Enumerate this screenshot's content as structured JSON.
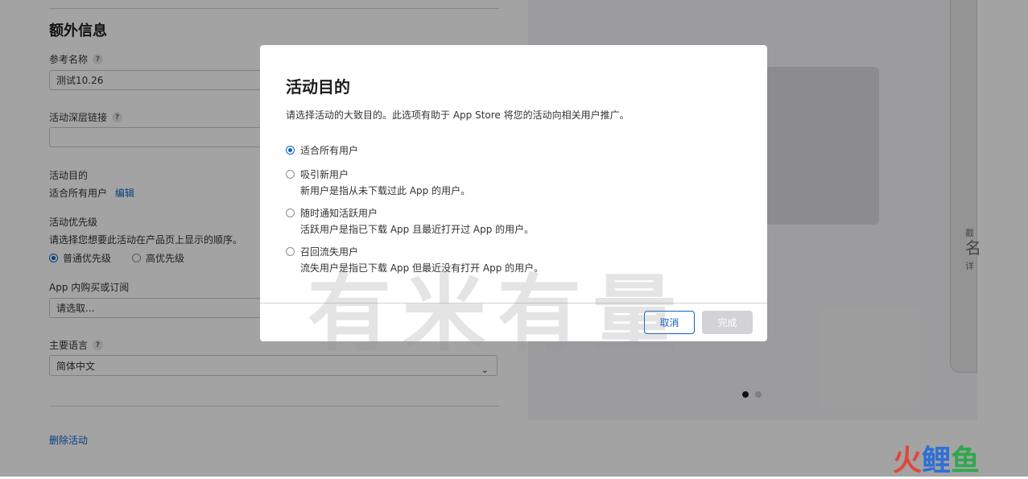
{
  "form": {
    "section_title": "额外信息",
    "ref_name": {
      "label": "参考名称",
      "help": "?",
      "value": "测试10.26"
    },
    "deep_link": {
      "label": "活动深层链接",
      "help": "?",
      "value": ""
    },
    "purpose": {
      "label": "活动目的",
      "value": "适合所有用户",
      "edit": "编辑"
    },
    "priority": {
      "label": "活动优先级",
      "desc": "请选择您想要此活动在产品页上显示的顺序。",
      "options": [
        {
          "label": "普通优先级",
          "selected": true
        },
        {
          "label": "高优先级",
          "selected": false
        }
      ]
    },
    "iap": {
      "label": "App 内购买或订阅",
      "placeholder": "请选取..."
    },
    "language": {
      "label": "主要语言",
      "help": "?",
      "value": "简体中文"
    },
    "delete_link": "删除活动"
  },
  "preview": {
    "device_text_top": "截",
    "device_text_big": "名",
    "device_text_bottom": "详",
    "page_dots": {
      "count": 2,
      "active": 1
    }
  },
  "modal": {
    "title": "活动目的",
    "description": "请选择活动的大致目的。此选项有助于 App Store 将您的活动向相关用户推广。",
    "options": [
      {
        "label": "适合所有用户",
        "sub": "",
        "selected": true
      },
      {
        "label": "吸引新用户",
        "sub": "新用户是指从未下载过此 App 的用户。",
        "selected": false
      },
      {
        "label": "随时通知活跃用户",
        "sub": "活跃用户是指已下载 App 且最近打开过 App 的用户。",
        "selected": false
      },
      {
        "label": "召回流失用户",
        "sub": "流失用户是指已下载 App 但最近没有打开 App 的用户。",
        "selected": false
      }
    ],
    "cancel_label": "取消",
    "done_label": "完成"
  },
  "watermarks": {
    "center": "有米有量",
    "corner": [
      "火",
      "鲤",
      "鱼"
    ]
  },
  "colors": {
    "accent": "#0a63c9",
    "overlay": "rgba(0,0,0,0.36)",
    "disabled_button": "#d2d2d7"
  }
}
